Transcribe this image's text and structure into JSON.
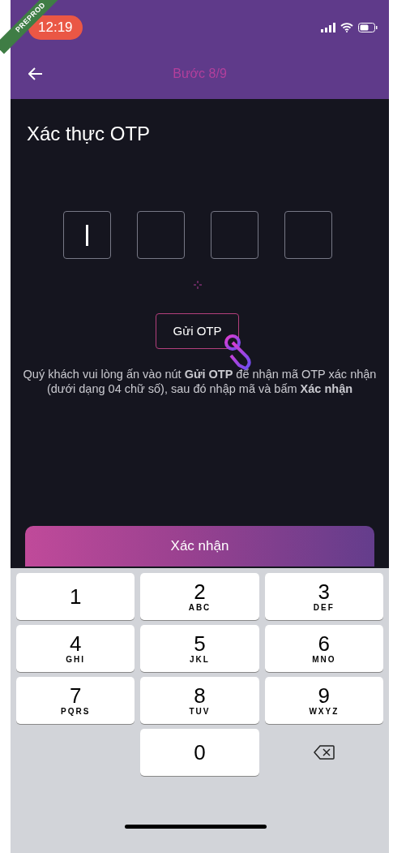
{
  "ribbon": "PREPROD",
  "status_bar": {
    "time": "12:19"
  },
  "header": {
    "step": "Bước 8/9"
  },
  "title": "Xác thực OTP",
  "otp_boxes": [
    {
      "focused": true
    },
    {
      "focused": false
    },
    {
      "focused": false
    },
    {
      "focused": false
    }
  ],
  "send_button": "Gửi OTP",
  "instructions": "Quý khách vui lòng ấn vào nút **Gửi OTP** để nhận mã OTP xác nhận (dưới dạng 04 chữ số), sau đó nhập mã và bấm **Xác nhận**",
  "confirm_button": "Xác nhận",
  "keypad": [
    {
      "kind": "digit",
      "digit": "1"
    },
    {
      "kind": "digit",
      "digit": "2",
      "letters": "ABC"
    },
    {
      "kind": "digit",
      "digit": "3",
      "letters": "DEF"
    },
    {
      "kind": "digit",
      "digit": "4",
      "letters": "GHI"
    },
    {
      "kind": "digit",
      "digit": "5",
      "letters": "JKL"
    },
    {
      "kind": "digit",
      "digit": "6",
      "letters": "MNO"
    },
    {
      "kind": "digit",
      "digit": "7",
      "letters": "PQRS"
    },
    {
      "kind": "digit",
      "digit": "8",
      "letters": "TUV"
    },
    {
      "kind": "digit",
      "digit": "9",
      "letters": "WXYZ"
    },
    {
      "kind": "blank"
    },
    {
      "kind": "digit",
      "digit": "0"
    },
    {
      "kind": "delete"
    }
  ]
}
